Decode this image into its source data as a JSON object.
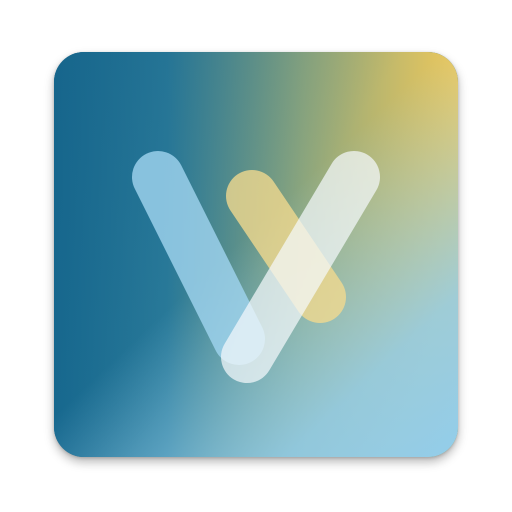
{
  "icon": {
    "name": "v-logo-icon",
    "colors": {
      "gradient_dark_blue": "#17698f",
      "gradient_mid_blue": "#2d7ea0",
      "gradient_yellow": "#edc85c",
      "gradient_light_blue": "#92cdeb",
      "stroke_light_blue": "#9fd3ee",
      "stroke_yellow": "#f3da8e",
      "stroke_white": "#f4f8fb"
    }
  }
}
